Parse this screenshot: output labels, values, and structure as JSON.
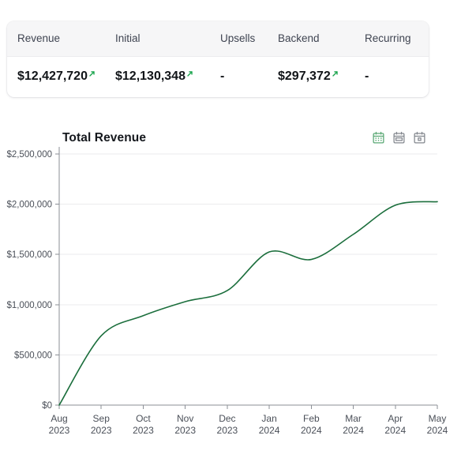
{
  "summary": {
    "columns": [
      {
        "key": "revenue",
        "label": "Revenue"
      },
      {
        "key": "initial",
        "label": "Initial"
      },
      {
        "key": "upsells",
        "label": "Upsells"
      },
      {
        "key": "backend",
        "label": "Backend"
      },
      {
        "key": "recurring",
        "label": "Recurring"
      }
    ],
    "row": [
      {
        "value": "$12,427,720",
        "trend": "up"
      },
      {
        "value": "$12,130,348",
        "trend": "up"
      },
      {
        "value": "-",
        "trend": "none"
      },
      {
        "value": "$297,372",
        "trend": "up"
      },
      {
        "value": "-",
        "trend": "none"
      }
    ]
  },
  "chart_header": {
    "title": "Total Revenue",
    "actions": [
      {
        "name": "calendar-day-icon",
        "label": "Day",
        "active": true
      },
      {
        "name": "calendar-week-icon",
        "label": "Week",
        "active": false
      },
      {
        "name": "calendar-month-icon",
        "label": "Month",
        "active": false
      }
    ]
  },
  "colors": {
    "accent_green": "#1b6e3c",
    "trend_up_green": "#19a44c",
    "icon_active": "#5aa874",
    "icon_inactive": "#83878e",
    "gridline": "#ebebed",
    "axis": "#8b8f96",
    "tick_text": "#4a4f58"
  },
  "chart_data": {
    "type": "line",
    "title": "Total Revenue",
    "xlabel": "",
    "ylabel": "",
    "grid": true,
    "legend": false,
    "ylim": [
      0,
      2500000
    ],
    "yticks": [
      0,
      500000,
      1000000,
      1500000,
      2000000,
      2500000
    ],
    "ytick_labels": [
      "$0",
      "$500,000",
      "$1,000,000",
      "$1,500,000",
      "$2,000,000",
      "$2,500,000"
    ],
    "categories": [
      "Aug\n2023",
      "Sep\n2023",
      "Oct\n2023",
      "Nov\n2023",
      "Dec\n2023",
      "Jan\n2024",
      "Feb\n2024",
      "Mar\n2024",
      "Apr\n2024",
      "May\n2024"
    ],
    "xtick_months": [
      "Aug",
      "Sep",
      "Oct",
      "Nov",
      "Dec",
      "Jan",
      "Feb",
      "Mar",
      "Apr",
      "May"
    ],
    "xtick_years": [
      "2023",
      "2023",
      "2023",
      "2023",
      "2023",
      "2024",
      "2024",
      "2024",
      "2024",
      "2024"
    ],
    "series": [
      {
        "name": "Total Revenue",
        "color": "#1b6e3c",
        "values": [
          0,
          690000,
          890000,
          1030000,
          1140000,
          1525000,
          1450000,
          1700000,
          1990000,
          2025000
        ]
      }
    ]
  }
}
